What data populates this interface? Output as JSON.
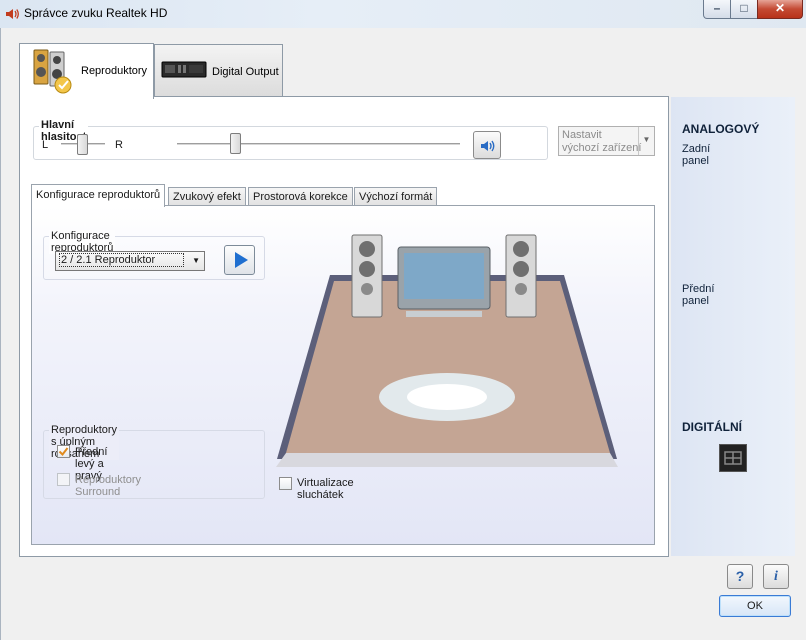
{
  "window": {
    "title": "Správce zvuku Realtek HD",
    "min_symbol": "–",
    "max_symbol": "□",
    "close_symbol": "✕"
  },
  "device_tabs": [
    {
      "label": "Reproduktory",
      "icon": "speakers-icon",
      "active": true
    },
    {
      "label": "Digital Output",
      "icon": "digital-output-icon",
      "active": false
    }
  ],
  "volume": {
    "group_label": "Hlavní hlasitost",
    "left_label": "L",
    "right_label": "R",
    "balance": 0.5,
    "level": 0.21,
    "default_device_line1": "Nastavit",
    "default_device_line2": "výchozí zařízení"
  },
  "sub_tabs": [
    {
      "label": "Konfigurace reproduktorů",
      "active": true
    },
    {
      "label": "Zvukový efekt",
      "active": false
    },
    {
      "label": "Prostorová korekce",
      "active": false
    },
    {
      "label": "Výchozí formát",
      "active": false
    }
  ],
  "speaker_config": {
    "group_label": "Konfigurace reproduktorů",
    "selected": "2 / 2.1 Reproduktor"
  },
  "full_range": {
    "group_label": "Reproduktory s úplným rozsahem",
    "front_label": "Přední levý a pravý",
    "front_checked": true,
    "surround_label": "Reproduktory Surround",
    "surround_checked": false
  },
  "headphone_virtualization": {
    "label": "Virtualizace sluchátek",
    "checked": false
  },
  "side": {
    "analog_title": "ANALOGOVÝ",
    "rear_panel": "Zadní panel",
    "front_panel": "Přední panel",
    "digital_title": "DIGITÁLNÍ",
    "rear_jacks": [
      "#c98a74",
      "#6f8fc8",
      "#8a8a8a",
      "#1e8a2a",
      "#9a9a9a",
      "#d5a3ad"
    ],
    "front_jacks": [
      "#1e8a2a",
      "#d5a3ad"
    ]
  },
  "buttons": {
    "help": "?",
    "info": "i",
    "ok": "OK"
  }
}
